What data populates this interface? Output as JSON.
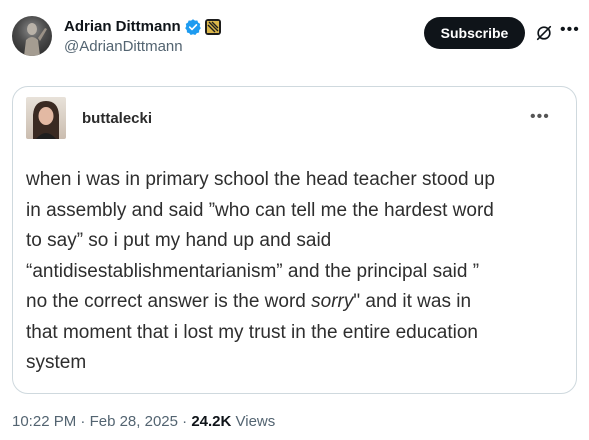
{
  "author": {
    "display_name": "Adrian Dittmann",
    "handle": "@AdrianDittmann",
    "verified_color": "#1d9bf0"
  },
  "actions": {
    "subscribe_label": "Subscribe",
    "grok_icon": "grok-icon",
    "more_icon": "more-icon"
  },
  "embedded_post": {
    "username": "buttalecki",
    "text_before_emphasis": "when i was in primary school the head teacher stood up\nin assembly and said ”who can tell me the hardest word\nto say” so i put my hand up and said\n“antidisestablishmentarianism” and the principal said ”\nno the correct answer is the word ",
    "emphasis": "sorry",
    "text_after_emphasis": "\" and it was in\nthat moment that i lost my trust in the entire education\nsystem"
  },
  "meta": {
    "time": "10:22 PM",
    "date": "Feb 28, 2025",
    "views_count": "24.2K",
    "views_label": "Views"
  }
}
